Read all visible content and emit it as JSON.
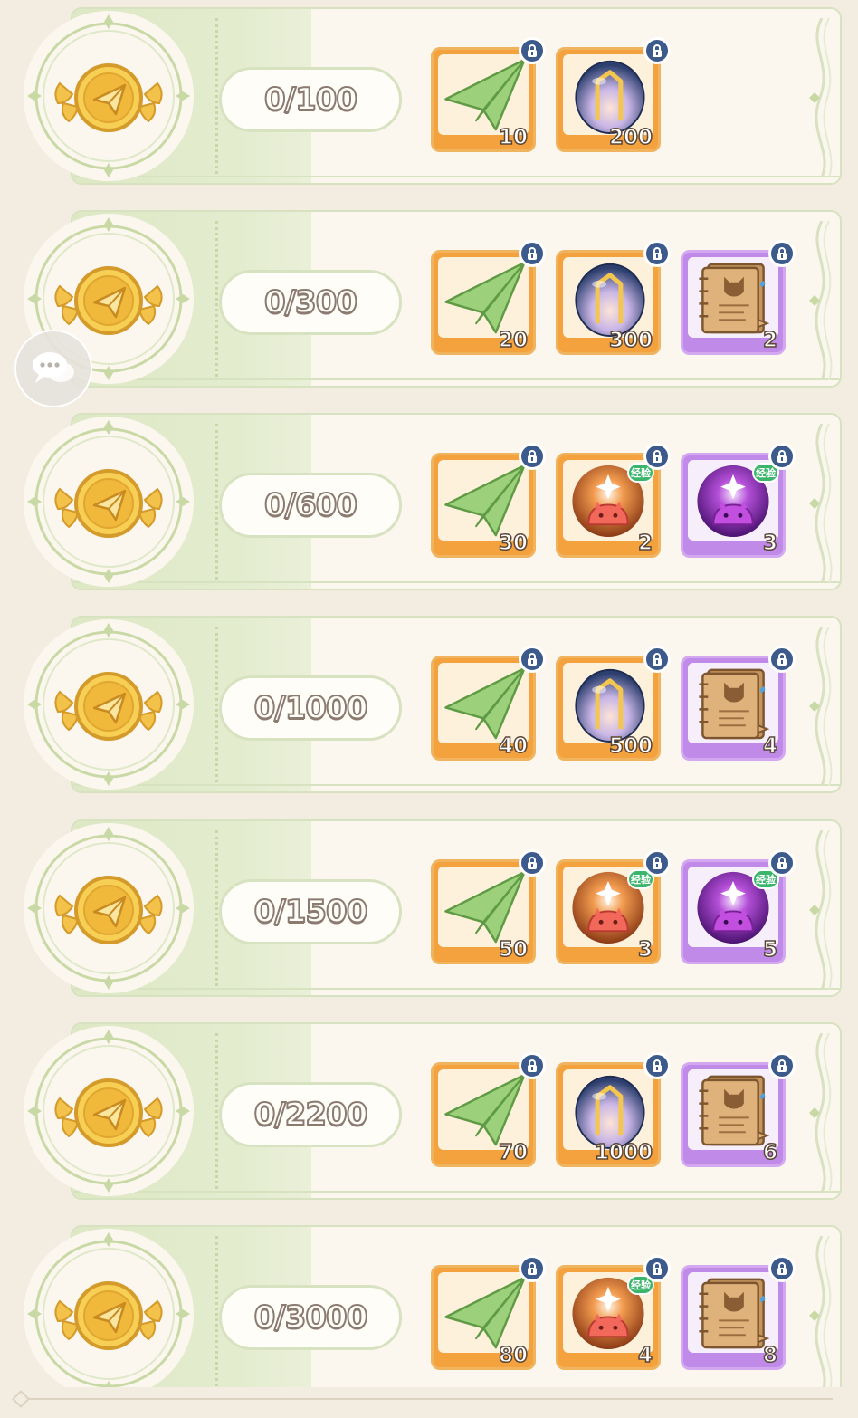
{
  "rows": [
    {
      "goal": "0/100",
      "rewards": [
        {
          "item": "paper-plane",
          "count": "10",
          "rarity": "orange",
          "exp": false
        },
        {
          "item": "crystal-orb",
          "count": "200",
          "rarity": "orange",
          "exp": false
        }
      ]
    },
    {
      "goal": "0/300",
      "rewards": [
        {
          "item": "paper-plane",
          "count": "20",
          "rarity": "orange",
          "exp": false
        },
        {
          "item": "crystal-orb",
          "count": "300",
          "rarity": "orange",
          "exp": false
        },
        {
          "item": "cat-notebook",
          "count": "2",
          "rarity": "purple",
          "exp": false
        }
      ]
    },
    {
      "goal": "0/600",
      "rewards": [
        {
          "item": "paper-plane",
          "count": "30",
          "rarity": "orange",
          "exp": false
        },
        {
          "item": "red-slime-exp",
          "count": "2",
          "rarity": "orange",
          "exp": true
        },
        {
          "item": "purple-slime-exp",
          "count": "3",
          "rarity": "purple",
          "exp": true
        }
      ]
    },
    {
      "goal": "0/1000",
      "rewards": [
        {
          "item": "paper-plane",
          "count": "40",
          "rarity": "orange",
          "exp": false
        },
        {
          "item": "crystal-orb",
          "count": "500",
          "rarity": "orange",
          "exp": false
        },
        {
          "item": "cat-notebook",
          "count": "4",
          "rarity": "purple",
          "exp": false
        }
      ]
    },
    {
      "goal": "0/1500",
      "rewards": [
        {
          "item": "paper-plane",
          "count": "50",
          "rarity": "orange",
          "exp": false
        },
        {
          "item": "red-slime-exp",
          "count": "3",
          "rarity": "orange",
          "exp": true
        },
        {
          "item": "purple-slime-exp",
          "count": "5",
          "rarity": "purple",
          "exp": true
        }
      ]
    },
    {
      "goal": "0/2200",
      "rewards": [
        {
          "item": "paper-plane",
          "count": "70",
          "rarity": "orange",
          "exp": false
        },
        {
          "item": "crystal-orb",
          "count": "1000",
          "rarity": "orange",
          "exp": false
        },
        {
          "item": "cat-notebook",
          "count": "6",
          "rarity": "purple",
          "exp": false
        }
      ]
    },
    {
      "goal": "0/3000",
      "rewards": [
        {
          "item": "paper-plane",
          "count": "80",
          "rarity": "orange",
          "exp": false
        },
        {
          "item": "red-slime-exp",
          "count": "4",
          "rarity": "orange",
          "exp": true
        },
        {
          "item": "cat-notebook",
          "count": "8",
          "rarity": "purple",
          "exp": false
        }
      ]
    }
  ],
  "exp_label": "经验",
  "icons": {
    "medal": "gold-paper-plane-medal-icon",
    "lock": "lock-icon",
    "chat": "chat-bubbles-icon"
  },
  "colors": {
    "row_band": "#dde8c4",
    "row_bg": "#fbf7ef",
    "orange_frame": "#f4a23e",
    "purple_frame": "#c08ae8",
    "lock_badge": "#3d5a8c",
    "exp_badge": "#3bb56b"
  }
}
